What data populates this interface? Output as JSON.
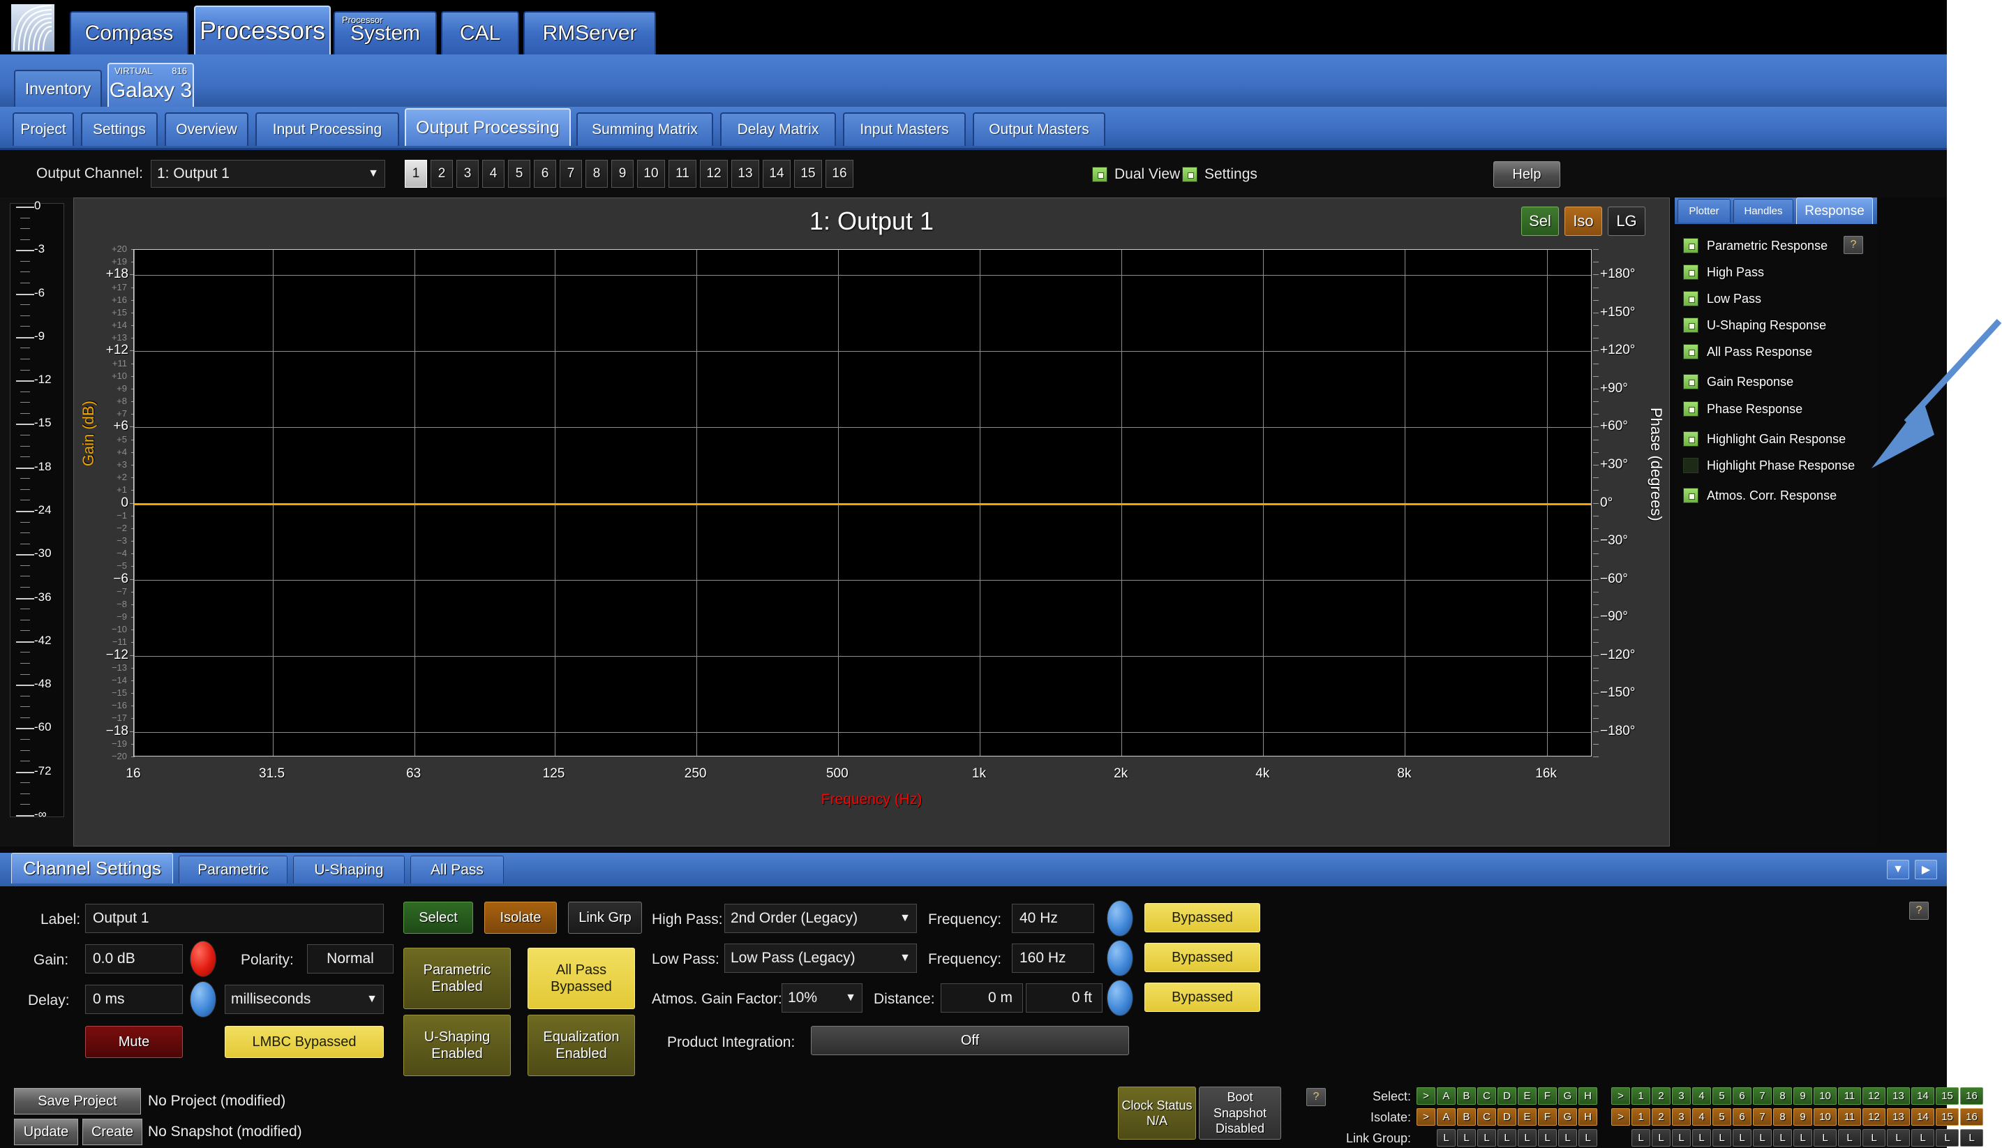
{
  "app": {
    "logo_icon": "meyer-sound-logo-icon"
  },
  "main_tabs": [
    {
      "label": "Compass",
      "active": false,
      "sup": ""
    },
    {
      "label": "Processors",
      "active": true,
      "sup": ""
    },
    {
      "label": "System",
      "active": false,
      "sup": "Processor"
    },
    {
      "label": "CAL",
      "active": false,
      "sup": ""
    },
    {
      "label": "RMServer",
      "active": false,
      "sup": ""
    }
  ],
  "device_tabs": [
    {
      "label": "Inventory",
      "active": false,
      "sup_left": "",
      "sup_right": ""
    },
    {
      "label": "Galaxy 3",
      "active": true,
      "sup_left": "VIRTUAL",
      "sup_right": "816"
    }
  ],
  "page_tabs": [
    {
      "label": "Project",
      "active": false
    },
    {
      "label": "Settings",
      "active": false
    },
    {
      "label": "Overview",
      "active": false
    },
    {
      "label": "Input Processing",
      "active": false
    },
    {
      "label": "Output Processing",
      "active": true
    },
    {
      "label": "Summing Matrix",
      "active": false
    },
    {
      "label": "Delay Matrix",
      "active": false
    },
    {
      "label": "Input Masters",
      "active": false
    },
    {
      "label": "Output Masters",
      "active": false
    }
  ],
  "channel_bar": {
    "label": "Output Channel:",
    "selected": "1: Output 1",
    "dropdown_icon": "chevron-down-icon",
    "channels": [
      "1",
      "2",
      "3",
      "4",
      "5",
      "6",
      "7",
      "8",
      "9",
      "10",
      "11",
      "12",
      "13",
      "14",
      "15",
      "16"
    ],
    "active_channel": "1",
    "dual_view": {
      "label": "Dual View",
      "checked": false
    },
    "settings": {
      "label": "Settings",
      "checked": true
    },
    "help_label": "Help"
  },
  "plot": {
    "title": "1: Output 1",
    "buttons": [
      {
        "label": "Sel",
        "kind": "sel"
      },
      {
        "label": "Iso",
        "kind": "iso"
      },
      {
        "label": "LG",
        "kind": "lg"
      }
    ]
  },
  "chart_data": {
    "type": "line",
    "title": "1: Output 1",
    "xlabel": "Frequency (Hz)",
    "ylabel": "Gain (dB)",
    "y2label": "Phase (degrees)",
    "xscale": "log",
    "xlim": [
      16,
      20000
    ],
    "ylim": [
      -20,
      20
    ],
    "y2lim": [
      -200,
      200
    ],
    "grid": true,
    "legend_position": "right-panel",
    "xticks": [
      "16",
      "31.5",
      "63",
      "125",
      "250",
      "500",
      "1k",
      "2k",
      "4k",
      "8k",
      "16k"
    ],
    "xtick_values": [
      16,
      31.5,
      63,
      125,
      250,
      500,
      1000,
      2000,
      4000,
      8000,
      16000
    ],
    "yticks_major": [
      "+18",
      "+12",
      "+6",
      "0",
      "-6",
      "-12",
      "-18"
    ],
    "yticks_major_values": [
      18,
      12,
      6,
      0,
      -6,
      -12,
      -18
    ],
    "yticks_minor": [
      "+20",
      "+19",
      "+17",
      "+16",
      "+15",
      "+14",
      "+13",
      "+11",
      "+10",
      "+9",
      "+8",
      "+7",
      "+5",
      "+4",
      "+3",
      "+2",
      "+1",
      "-1",
      "-2",
      "-3",
      "-4",
      "-5",
      "-7",
      "-8",
      "-9",
      "-10",
      "-11",
      "-13",
      "-14",
      "-15",
      "-16",
      "-17",
      "-19",
      "-20"
    ],
    "y2ticks": [
      "+180°",
      "+150°",
      "+120°",
      "+90°",
      "+60°",
      "+30°",
      "0°",
      "-30°",
      "-60°",
      "-90°",
      "-120°",
      "-150°",
      "-180°"
    ],
    "y2tick_values": [
      180,
      150,
      120,
      90,
      60,
      30,
      0,
      -30,
      -60,
      -90,
      -120,
      -150,
      -180
    ],
    "series": [
      {
        "name": "Gain Response",
        "color": "#f0a500",
        "values_db": 0,
        "description": "Flat 0 dB across 16 Hz to 20 kHz"
      }
    ]
  },
  "meter": {
    "ticks": [
      "0",
      "-3",
      "-6",
      "-9",
      "-12",
      "-15",
      "-18",
      "-24",
      "-30",
      "-36",
      "-42",
      "-48",
      "-60",
      "-72",
      "-∞"
    ],
    "values": [
      0,
      -3,
      -6,
      -9,
      -12,
      -15,
      -18,
      -24,
      -30,
      -36,
      -42,
      -48,
      -60,
      -72,
      -100
    ]
  },
  "response_panel": {
    "tabs": [
      {
        "label": "Plotter",
        "active": false
      },
      {
        "label": "Handles",
        "active": false
      },
      {
        "label": "Response",
        "active": true
      }
    ],
    "help_label": "?",
    "items": [
      {
        "label": "Parametric Response",
        "checked": true,
        "has_help": true
      },
      {
        "label": "High Pass",
        "checked": true,
        "has_help": false
      },
      {
        "label": "Low Pass",
        "checked": true,
        "has_help": false
      },
      {
        "label": "U-Shaping Response",
        "checked": true,
        "has_help": false
      },
      {
        "label": "All Pass Response",
        "checked": true,
        "has_help": false
      },
      {
        "label": "Gain Response",
        "checked": true,
        "has_help": false
      },
      {
        "label": "Phase Response",
        "checked": true,
        "has_help": false
      },
      {
        "label": "Highlight Gain Response",
        "checked": true,
        "has_help": false
      },
      {
        "label": "Highlight Phase Response",
        "checked": false,
        "has_help": false
      },
      {
        "label": "Atmos. Corr. Response",
        "checked": true,
        "has_help": false
      }
    ]
  },
  "bottom_tabs": [
    {
      "label": "Channel Settings",
      "active": true
    },
    {
      "label": "Parametric",
      "active": false
    },
    {
      "label": "U-Shaping",
      "active": false
    },
    {
      "label": "All Pass",
      "active": false
    }
  ],
  "bottom_nav": [
    {
      "icon": "chevron-down-icon",
      "glyph": "▼"
    },
    {
      "icon": "chevron-right-icon",
      "glyph": "▶"
    }
  ],
  "channel_settings": {
    "help_label": "?",
    "label_field": {
      "label": "Label:",
      "value": "Output 1"
    },
    "gain": {
      "label": "Gain:",
      "value": "0.0 dB",
      "knob": "red"
    },
    "polarity": {
      "label": "Polarity:",
      "value": "Normal"
    },
    "delay": {
      "label": "Delay:",
      "value": "0 ms",
      "knob": "blue",
      "unit": "milliseconds",
      "unit_icon": "chevron-down-icon"
    },
    "mute_label": "Mute",
    "lmbc_label": "LMBC Bypassed",
    "select_label": "Select",
    "isolate_label": "Isolate",
    "link_grp_label": "Link Grp",
    "parametric_label": "Parametric\nEnabled",
    "parametric_line1": "Parametric",
    "parametric_line2": "Enabled",
    "allpass_line1": "All Pass",
    "allpass_line2": "Bypassed",
    "ushaping_line1": "U-Shaping",
    "ushaping_line2": "Enabled",
    "equalization_line1": "Equalization",
    "equalization_line2": "Enabled",
    "high_pass": {
      "label": "High Pass:",
      "value": "2nd Order  (Legacy)",
      "freq_label": "Frequency:",
      "freq_value": "40 Hz",
      "bypass_label": "Bypassed",
      "icon": "chevron-down-icon"
    },
    "low_pass": {
      "label": "Low Pass:",
      "value": "Low Pass (Legacy)",
      "freq_label": "Frequency:",
      "freq_value": "160 Hz",
      "bypass_label": "Bypassed",
      "icon": "chevron-down-icon"
    },
    "atmos": {
      "label": "Atmos. Gain Factor:",
      "value": "10%",
      "distance_label": "Distance:",
      "distance_m": "0 m",
      "distance_ft": "0 ft",
      "bypass_label": "Bypassed",
      "icon": "chevron-down-icon"
    },
    "product_integration": {
      "label": "Product Integration:",
      "value": "Off"
    }
  },
  "status_bar": {
    "save_project_label": "Save Project",
    "project_status": "No Project (modified)",
    "update_label": "Update",
    "create_label": "Create",
    "snapshot_status": "No Snapshot (modified)",
    "clock_status_line1": "Clock Status",
    "clock_status_line2": "N/A",
    "boot_snapshot_line1": "Boot",
    "boot_snapshot_line2": "Snapshot",
    "boot_snapshot_line3": "Disabled",
    "help_label": "?",
    "matrix": {
      "select_label": "Select:",
      "isolate_label": "Isolate:",
      "link_group_label": "Link Group:",
      "groups": [
        "A",
        "B",
        "C",
        "D",
        "E",
        "F",
        "G",
        "H"
      ],
      "channels": [
        "1",
        "2",
        "3",
        "4",
        "5",
        "6",
        "7",
        "8",
        "9",
        "10",
        "11",
        "12",
        "13",
        "14",
        "15",
        "16"
      ],
      "expand_glyph": ">",
      "link_glyph": "L"
    }
  },
  "annotation": {
    "arrow_color": "#5b8ed1",
    "points_to": "Atmos. Corr. Response"
  }
}
